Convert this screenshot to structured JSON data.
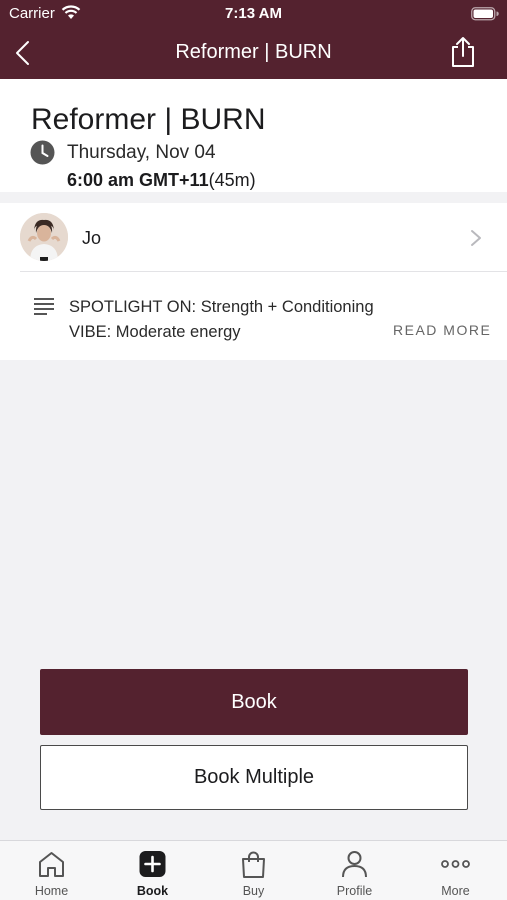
{
  "status_bar": {
    "carrier": "Carrier",
    "time": "7:13 AM"
  },
  "nav": {
    "title": "Reformer | BURN",
    "back_icon": "chevron-left-icon",
    "share_icon": "share-icon"
  },
  "class": {
    "title": "Reformer | BURN",
    "date": "Thursday, Nov 04",
    "time": "6:00 am GMT+11",
    "duration": "(45m)"
  },
  "instructor": {
    "name": "Jo"
  },
  "description": {
    "line1": "SPOTLIGHT ON: Strength + Conditioning",
    "line2": "VIBE: Moderate energy",
    "read_more": "READ MORE"
  },
  "buttons": {
    "book": "Book",
    "book_multiple": "Book Multiple"
  },
  "tabs": [
    {
      "label": "Home",
      "icon": "home-icon",
      "active": false
    },
    {
      "label": "Book",
      "icon": "plus-square-icon",
      "active": true
    },
    {
      "label": "Buy",
      "icon": "shopping-bag-icon",
      "active": false
    },
    {
      "label": "Profile",
      "icon": "person-icon",
      "active": false
    },
    {
      "label": "More",
      "icon": "more-dots-icon",
      "active": false
    }
  ],
  "colors": {
    "brand": "#54222f",
    "background": "#f2f2f4"
  }
}
